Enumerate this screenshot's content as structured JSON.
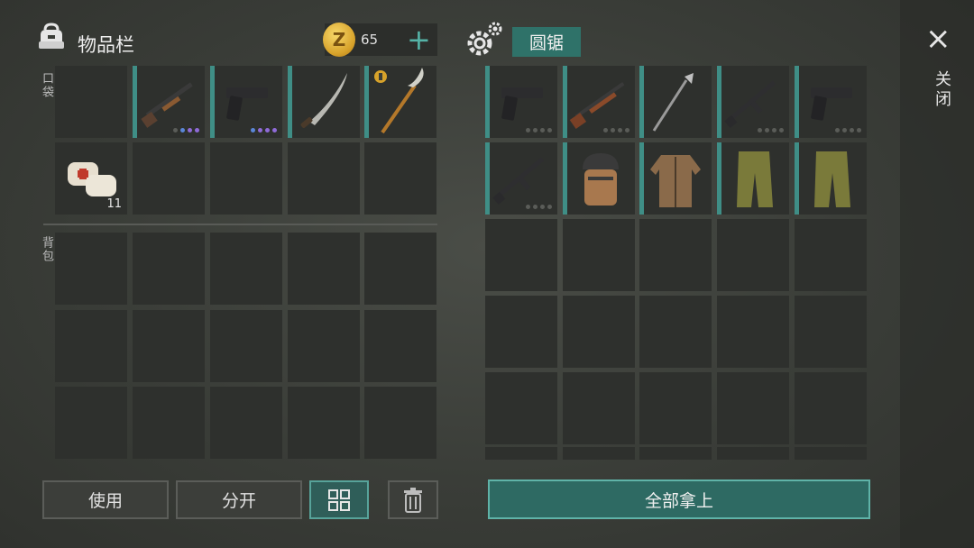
{
  "inventory": {
    "title": "物品栏",
    "coins": "65",
    "coin_symbol": "Z",
    "pocket_label": "口袋",
    "backpack_label": "背包",
    "bandage_count": "11"
  },
  "container": {
    "title": "圆锯"
  },
  "buttons": {
    "use": "使用",
    "split": "分开",
    "take_all": "全部拿上"
  },
  "close": {
    "icon": "×",
    "label": "关闭"
  },
  "colors": {
    "accent": "#3f8e86",
    "purple_dot": "#8f6bd8"
  },
  "icons": [
    "backpack-icon",
    "gear-icon",
    "plus-icon",
    "grid-icon",
    "trash-icon",
    "close-icon"
  ]
}
